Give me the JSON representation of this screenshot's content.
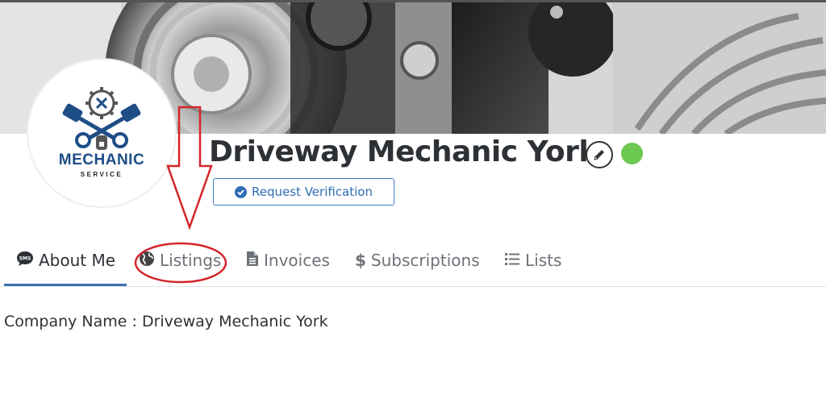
{
  "profile": {
    "name": "Driveway Mechanic York",
    "verify_label": "Request Verification",
    "status_color": "#6cc84f",
    "accent_color": "#3b6fb0"
  },
  "logo": {
    "main": "MECHANIC",
    "sub": "SERVICE"
  },
  "tabs": [
    {
      "label": "About Me",
      "icon": "sms-icon",
      "active": true
    },
    {
      "label": "Listings",
      "icon": "globe-icon",
      "active": false
    },
    {
      "label": "Invoices",
      "icon": "document-icon",
      "active": false
    },
    {
      "label": "Subscriptions",
      "icon": "dollar-icon",
      "active": false
    },
    {
      "label": "Lists",
      "icon": "list-icon",
      "active": false
    }
  ],
  "about": {
    "company_label": "Company Name : Driveway Mechanic York"
  }
}
